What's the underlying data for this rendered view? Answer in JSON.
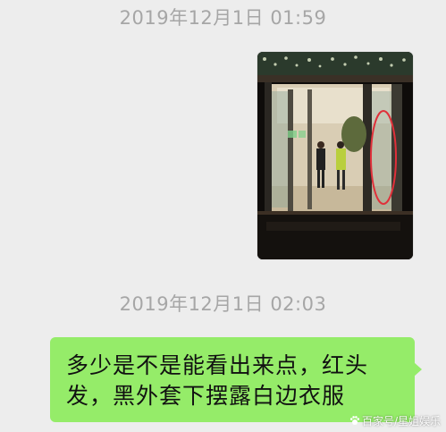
{
  "timestamps": [
    "2019年12月1日  01:59",
    "2019年12月1日  02:03"
  ],
  "image_message": {
    "accent_circle_color": "#e0303a"
  },
  "text_message": {
    "line1": "多少是不是能看出来点，红头",
    "line2": "发，黑外套下摆露白边衣服",
    "bubble_color": "#95ec69"
  },
  "watermark": {
    "text": "百家号/星姐娱乐",
    "icon": "paw-icon"
  }
}
